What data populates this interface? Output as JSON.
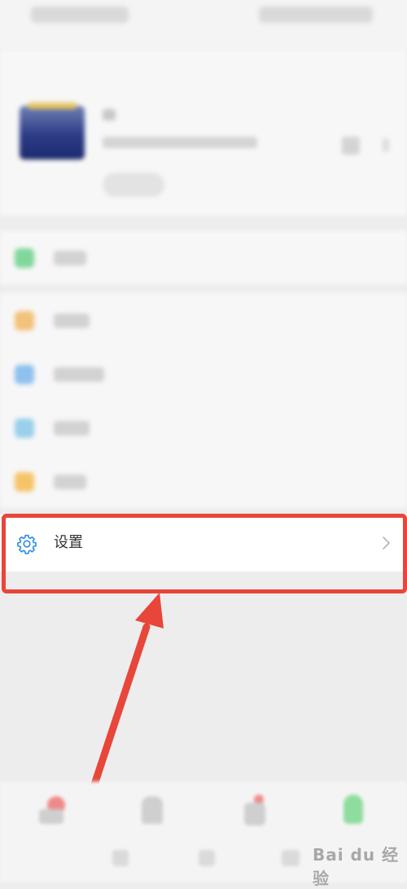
{
  "settings_row": {
    "label": "设置"
  },
  "watermark": {
    "text": "Bai du 经验"
  },
  "icons": {
    "settings": "gear-icon",
    "chevron": "chevron-right-icon"
  },
  "colors": {
    "highlight": "#e8463a",
    "arrow": "#e8463a",
    "settings_icon": "#2e8ee6",
    "background": "#ededed"
  }
}
